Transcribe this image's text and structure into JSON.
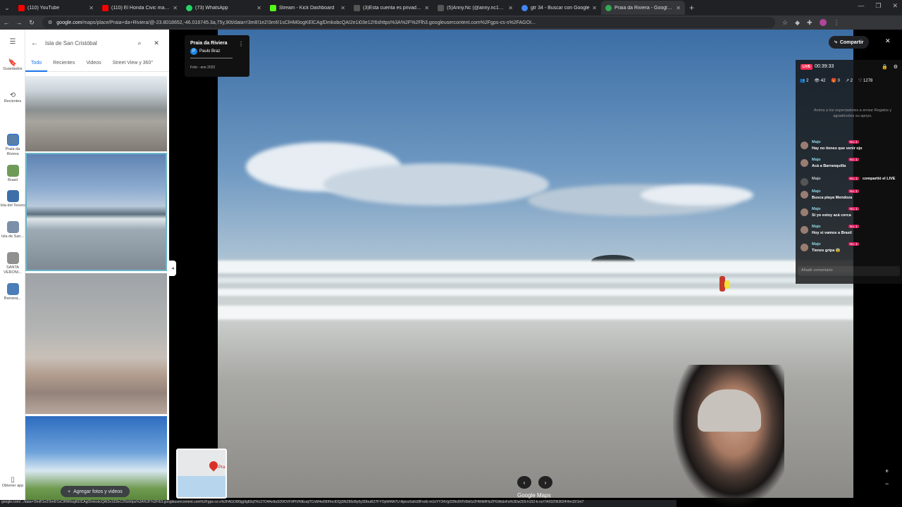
{
  "browser": {
    "tabs": [
      {
        "title": "(110) YouTube",
        "color": "#ff0000"
      },
      {
        "title": "(110) El Honda Civic mas barat",
        "color": "#ff0000"
      },
      {
        "title": "(73) WhatsApp",
        "color": "#25d366"
      },
      {
        "title": "Stream - Kick Dashboard",
        "color": "#53fc18"
      },
      {
        "title": "(3)Esta cuenta es privada. Sigue",
        "color": "#111111"
      },
      {
        "title": "(5)Anny.Nc (@anny.nc19) | TikT",
        "color": "#111111"
      },
      {
        "title": "gtr 34 - Buscar con Google",
        "color": "#4285f4"
      },
      {
        "title": "Praia da Riviera - Google Maps",
        "color": "#34a853"
      }
    ],
    "url_domain": "google.com",
    "url_rest": "/maps/place/Praia+da+Riviera/@-23.8018652,-46.016745.3a,75y,90t/data=!3m8!1e2!3m6!1sClHM0ogKElCAglDmkobcQAI2e1i03e12!6shttps%3A%2F%2Flh3.googleusercontent.com%2Fgps-cs-s%2FAGOI..."
  },
  "rail": {
    "items": [
      {
        "label": "Guardados",
        "icon": "bookmark-icon"
      },
      {
        "label": "Recientes",
        "icon": "history-icon"
      },
      {
        "label": "Praia da Riviera",
        "thumb": "#5a7fa8"
      },
      {
        "label": "Brasil",
        "thumb": "#6f9b58"
      },
      {
        "label": "Isla del Tesoro",
        "thumb": "#3d6fa8"
      },
      {
        "label": "Isla de San...",
        "thumb": "#7b90a8"
      },
      {
        "label": "SANTA VERONI...",
        "thumb": "#909090"
      },
      {
        "label": "Barranq...",
        "thumb": "#4b7db8"
      }
    ],
    "get_app": "Obtener app"
  },
  "panel": {
    "search_value": "Isla de San Cristóbal",
    "tabs": [
      "Todo",
      "Recientes",
      "Videos",
      "Street View y 360°"
    ],
    "add_photos": "Agregar fotos y videos"
  },
  "photo": {
    "place": "Praia da Riviera",
    "author": "Paulo Braz",
    "author_initial": "P",
    "date": "Foto - ene 2022",
    "minimap_label": "Pra",
    "logo": "Google Maps",
    "share": "Compartir"
  },
  "status_url": "google.com/.../data=!3m8!1e2!3m6!1sClHM0ogKElCAglDmkobcQAI2e1i03e12!6shttps%3A%2F%2Flh3.googleusercontent.com%2Fgps-cs-s%2FAGOI8Sjg9g83qTRc27O4An9uSD9OVF9PtVNlEuqiTCnM4w09IHncIDQjSNZ89zBy0y3DbuRZ7FYOpW4IA7U-tkjexc6ahU8FxnE-m1oYY34VgD3Nc8VlV6tk0z2HWkMHzZPGWaIxFa%3Dw203-h152-k-no!7i4032!8i3024!4m15!1m7",
  "live": {
    "badge": "LIVE",
    "time": "00:39:33",
    "stats": {
      "viewers_joined": "2",
      "views": "42",
      "gifts": "0",
      "shares": "2",
      "likes": "1278"
    },
    "hint": "Anima a los espectadores a enviar Regalos y agradéceles su apoyo.",
    "level": "No. 1",
    "comments": [
      {
        "user": "Majo",
        "text": "Hay no tienes que venir ojo"
      },
      {
        "user": "Majo",
        "text": "Acá a Barranquilla"
      },
      {
        "user": "Majo",
        "text": "compartió el LIVE",
        "share": true
      },
      {
        "user": "Majo",
        "text": "Busca playa Mendoza"
      },
      {
        "user": "Majo",
        "text": "Si yo estoy acá cerca"
      },
      {
        "user": "Majo",
        "text": "Hoy si vamos a Brasil"
      },
      {
        "user": "Majo",
        "text": "Tienes gripa 😨"
      }
    ],
    "add_comment_placeholder": "Añadir comentario"
  }
}
